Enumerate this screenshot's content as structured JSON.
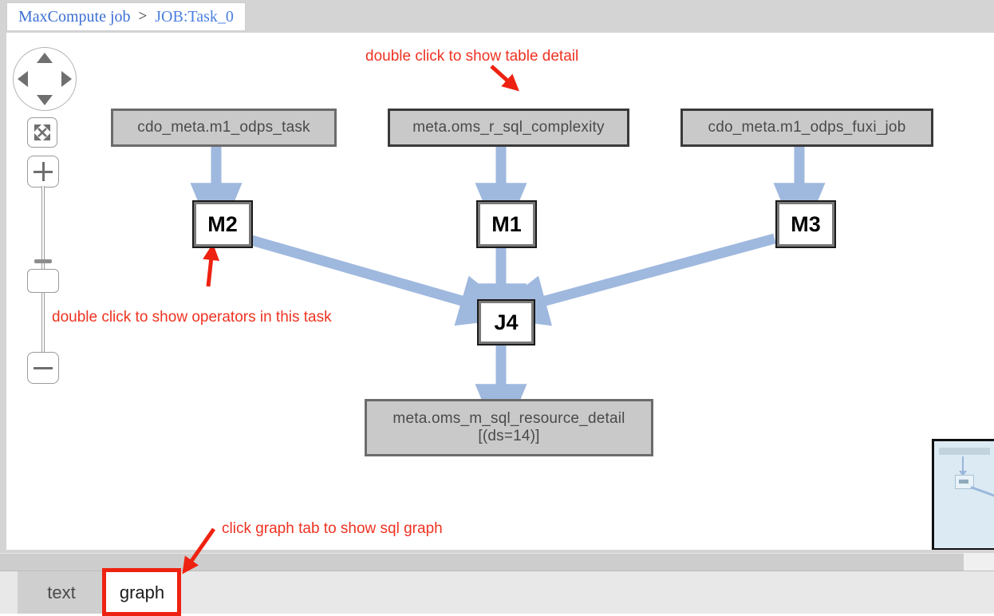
{
  "breadcrumb": {
    "root_label": "MaxCompute job",
    "separator": ">",
    "current_label": "JOB:Task_0"
  },
  "nav_controls": {
    "pan_up": "pan-up",
    "pan_down": "pan-down",
    "pan_left": "pan-left",
    "pan_right": "pan-right",
    "fit_label": "fit-to-screen",
    "zoom_in_label": "+",
    "zoom_out_label": "-"
  },
  "graph": {
    "tables": [
      {
        "id": "t1",
        "label": "cdo_meta.m1_odps_task"
      },
      {
        "id": "t2",
        "label": "meta.oms_r_sql_complexity"
      },
      {
        "id": "t3",
        "label": "cdo_meta.m1_odps_fuxi_job"
      }
    ],
    "tasks": [
      {
        "id": "m2",
        "label": "M2"
      },
      {
        "id": "m1",
        "label": "M1"
      },
      {
        "id": "m3",
        "label": "M3"
      },
      {
        "id": "j4",
        "label": "J4"
      }
    ],
    "output": {
      "label_line1": "meta.oms_m_sql_resource_detail",
      "label_line2": "[(ds=14)]"
    },
    "edge_color": "#9fb8de",
    "table_fill": "#c9c9c9",
    "table_border": "#6b6b6b",
    "task_fill": "#ffffff",
    "task_border": "#1a1a1a"
  },
  "annotations": {
    "color": "#ee3322",
    "table_detail": "double click to show table detail",
    "operators": "double click to show operators in this task",
    "graph_tab": "click graph tab to show sql graph"
  },
  "tabs": [
    {
      "id": "text",
      "label": "text",
      "active": false
    },
    {
      "id": "graph",
      "label": "graph",
      "active": true
    }
  ],
  "minimap": {
    "name": "graph-overview-minimap"
  }
}
